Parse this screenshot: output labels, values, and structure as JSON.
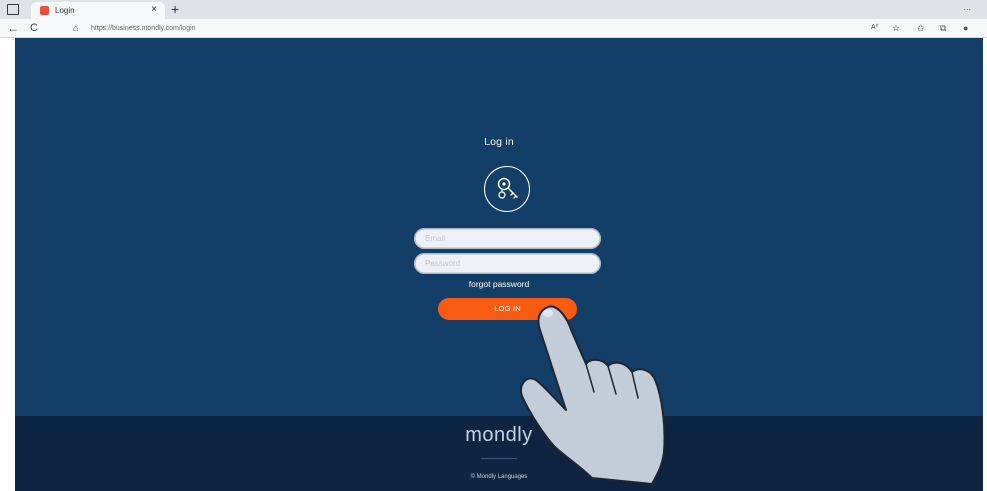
{
  "browser": {
    "tab_title": "Login",
    "tab_close": "×",
    "new_tab": "+",
    "more": "...",
    "back": "←",
    "refresh": "C",
    "url": "https://business.mondly.com/login",
    "read_aloud": "A⁰",
    "accent_favicon": "#e8513d"
  },
  "login": {
    "title": "Log in",
    "icon": "key-icon",
    "email_placeholder": "Email",
    "password_placeholder": "Password",
    "forgot_password": "forgot password",
    "login_button": "LOG IN",
    "button_color": "#fa5b12",
    "background_color": "#123e68"
  },
  "footer": {
    "brand": "mondly",
    "copyright": "© Mondly Languages",
    "background_color": "#0d2540"
  },
  "overlay": {
    "icon": "pointing-hand-icon"
  }
}
